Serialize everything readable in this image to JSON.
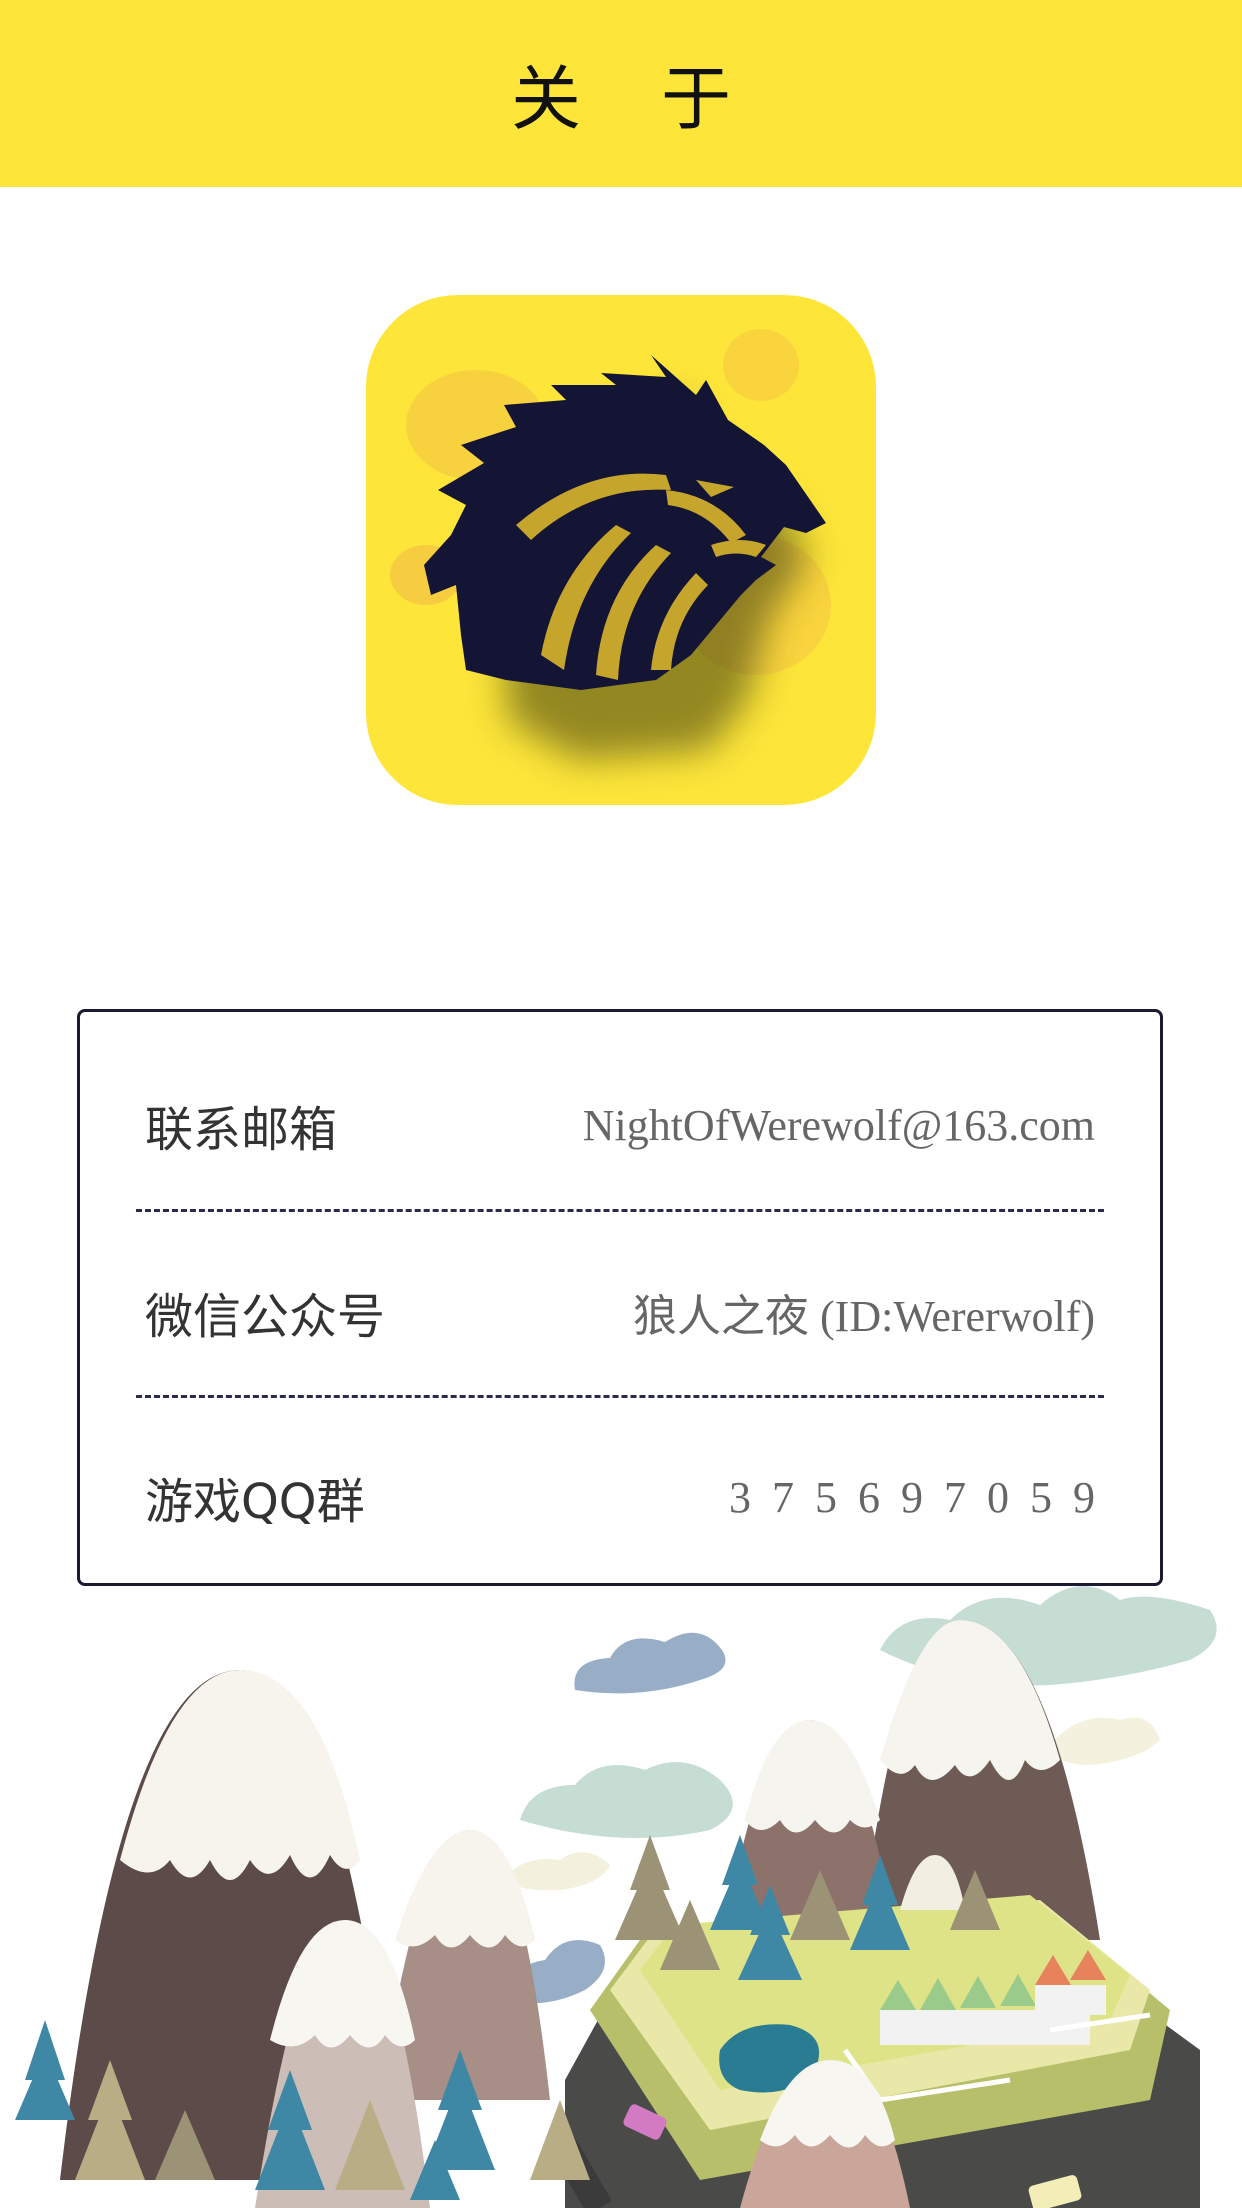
{
  "header": {
    "title": "关于"
  },
  "app_icon": {
    "name": "werewolf-logo-icon",
    "background": "#FDE53A",
    "logo_color": "#141434"
  },
  "info": {
    "email": {
      "label": "联系邮箱",
      "value": "NightOfWerewolf@163.com"
    },
    "wechat": {
      "label": "微信公众号",
      "value": "狼人之夜 (ID:Wererwolf)"
    },
    "qq_group": {
      "label": "游戏QQ群",
      "value": "375697059"
    }
  },
  "colors": {
    "accent": "#FDE53A",
    "border": "#1a1a33"
  }
}
